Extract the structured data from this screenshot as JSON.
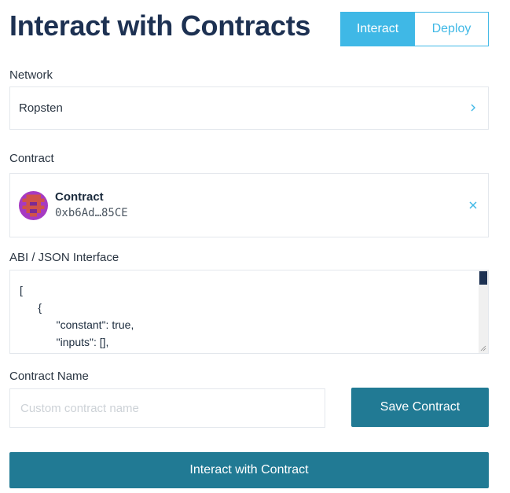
{
  "header": {
    "title": "Interact with Contracts",
    "tabs": [
      {
        "label": "Interact",
        "active": true
      },
      {
        "label": "Deploy",
        "active": false
      }
    ]
  },
  "network": {
    "label": "Network",
    "value": "Ropsten",
    "icon": "chevron-right-icon"
  },
  "contract": {
    "label": "Contract",
    "name": "Contract",
    "address": "0xb6Ad…85CE",
    "icon": "close-icon"
  },
  "abi": {
    "label": "ABI / JSON Interface",
    "lines": [
      "[",
      "      {",
      "            \"constant\": true,",
      "            \"inputs\": [],"
    ]
  },
  "contract_name": {
    "label": "Contract Name",
    "placeholder": "Custom contract name",
    "value": "",
    "save_label": "Save Contract"
  },
  "actions": {
    "interact_label": "Interact with Contract"
  },
  "colors": {
    "accent": "#3fb8e6",
    "button": "#217a94",
    "title": "#1d3152"
  }
}
